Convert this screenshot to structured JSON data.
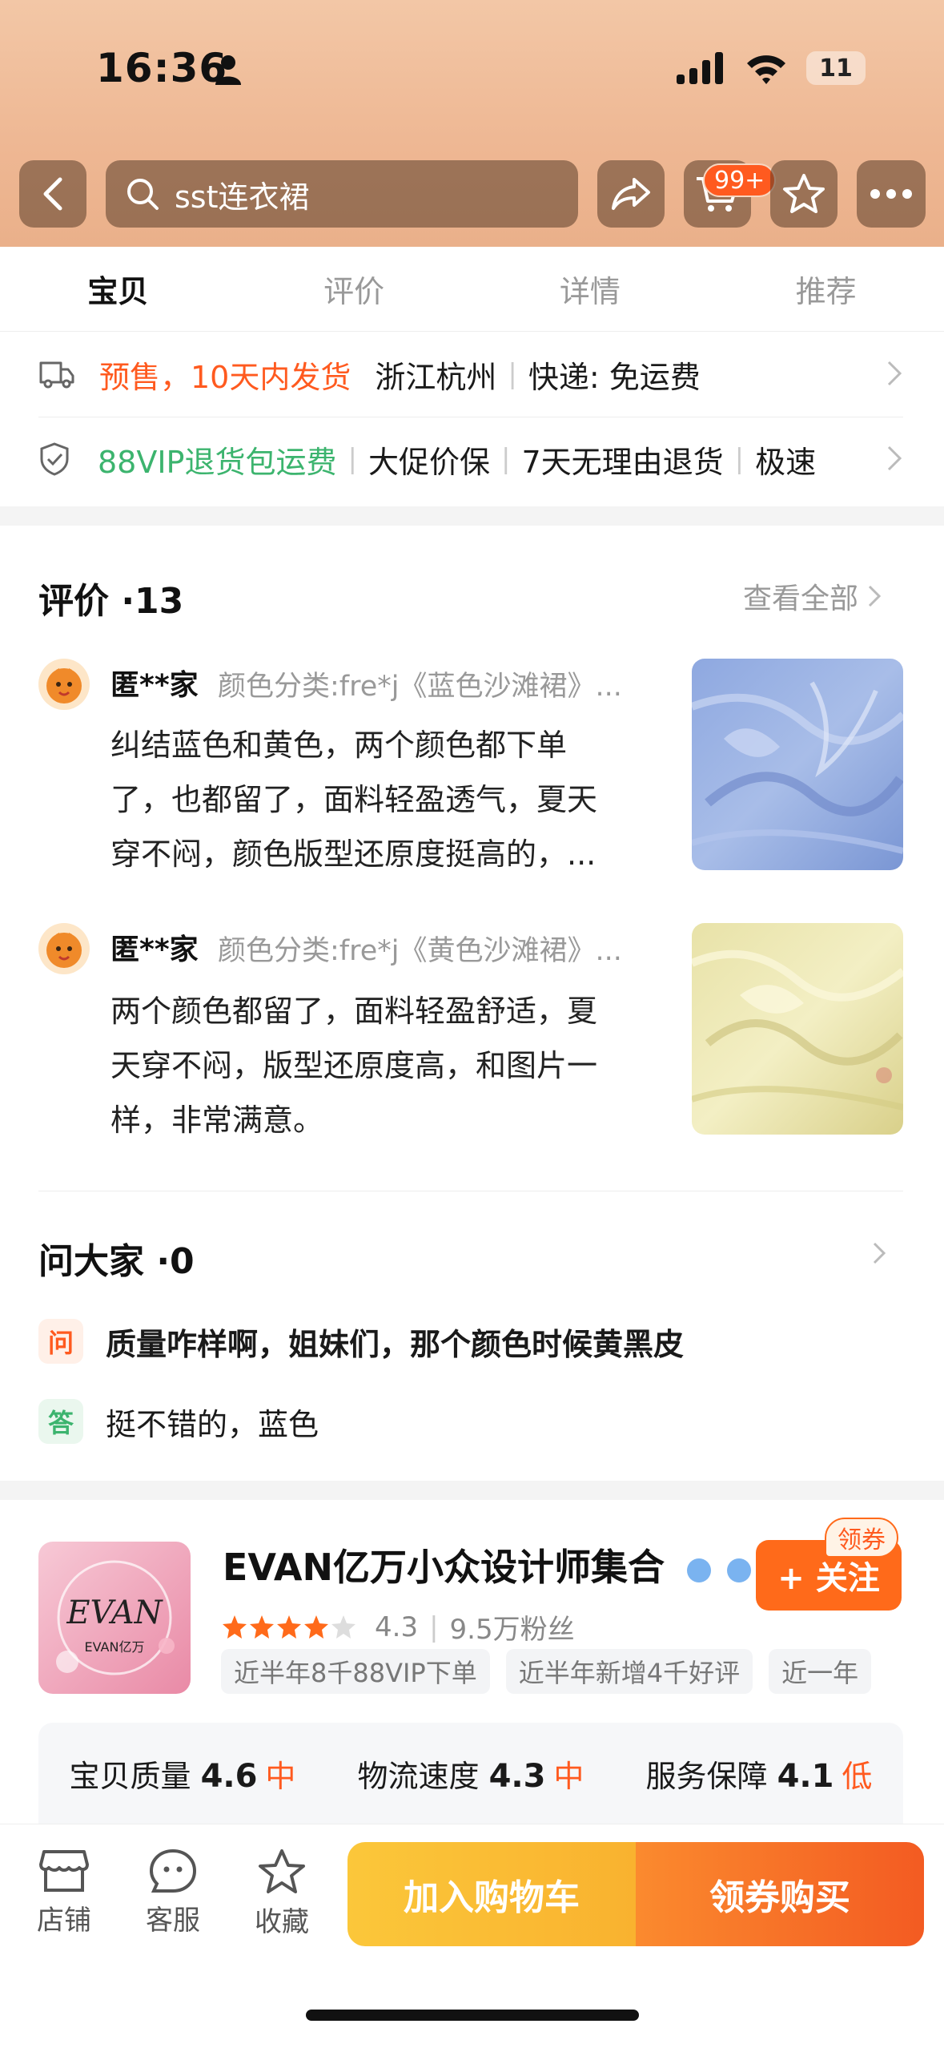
{
  "status_bar": {
    "time": "16:36",
    "battery": "11"
  },
  "header": {
    "search_text": "sst连衣裙",
    "cart_badge": "99+"
  },
  "tabs": [
    {
      "label": "宝贝",
      "active": true
    },
    {
      "label": "评价",
      "active": false
    },
    {
      "label": "详情",
      "active": false
    },
    {
      "label": "推荐",
      "active": false
    }
  ],
  "shipping": {
    "presale": "预售，10天内发货",
    "location": "浙江杭州",
    "express": "快递: 免运费"
  },
  "services": {
    "vip_return": "88VIP退货包运费",
    "price_protect": "大促价保",
    "no_reason": "7天无理由退货",
    "fast": "极速"
  },
  "reviews": {
    "title": "评价 ·13",
    "see_all": "查看全部",
    "items": [
      {
        "user": "匿**家",
        "spec": "颜色分类:fre*j《蓝色沙滩裙》...",
        "line1": "纠结蓝色和黄色，两个颜色都下单",
        "line2": "了，也都留了，面料轻盈透气，夏天",
        "line3": "穿不闷，颜色版型还原度挺高的，..."
      },
      {
        "user": "匿**家",
        "spec": "颜色分类:fre*j《黄色沙滩裙》...",
        "line1": "两个颜色都留了，面料轻盈舒适，夏",
        "line2": "天穿不闷，版型还原度高，和图片一",
        "line3": "样，非常满意。"
      }
    ]
  },
  "qa": {
    "title": "问大家 ·0",
    "q_icon": "问",
    "question": "质量咋样啊，姐妹们，那个颜色时候黄黑皮",
    "a_icon": "答",
    "answer": "挺不错的，蓝色"
  },
  "shop": {
    "logo_text": "EVAN亿万",
    "name": "EVAN亿万小众设计师集合",
    "follow": "+ 关注",
    "coupon": "领券",
    "rating": "4.3",
    "fans": "9.5万粉丝",
    "tags": [
      "近半年8千88VIP下单",
      "近半年新增4千好评",
      "近一年"
    ],
    "scores": [
      {
        "label": "宝贝质量",
        "value": "4.6",
        "level": "中"
      },
      {
        "label": "物流速度",
        "value": "4.3",
        "level": "中"
      },
      {
        "label": "服务保障",
        "value": "4.1",
        "level": "低"
      }
    ]
  },
  "bottom_bar": {
    "store": "店铺",
    "service": "客服",
    "favorite": "收藏",
    "add_cart": "加入购物车",
    "buy": "领券购买"
  },
  "colors": {
    "accent": "#ff5a1f",
    "vip_green": "#3cb46e",
    "header": "#eeb793"
  }
}
